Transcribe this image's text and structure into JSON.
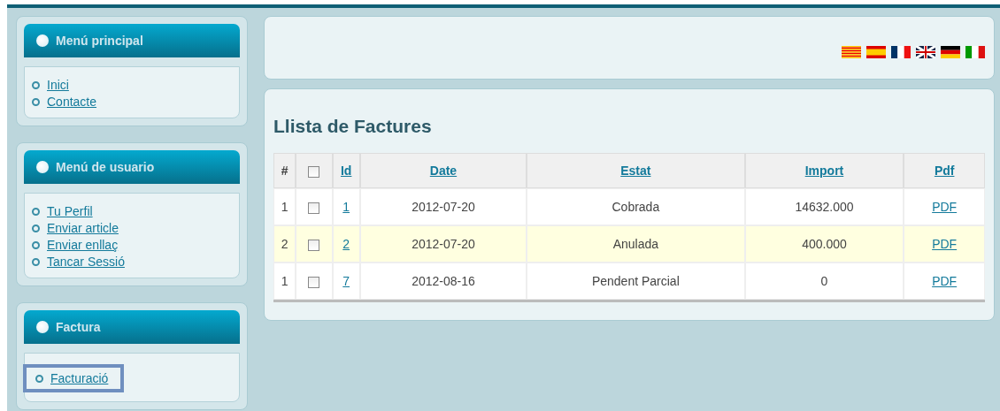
{
  "sidebar": [
    {
      "title": "Menú principal",
      "items": [
        {
          "label": "Inici",
          "highlighted": false
        },
        {
          "label": "Contacte",
          "highlighted": false
        }
      ]
    },
    {
      "title": "Menú de usuario",
      "items": [
        {
          "label": "Tu Perfil",
          "highlighted": false
        },
        {
          "label": "Enviar article",
          "highlighted": false
        },
        {
          "label": "Enviar enllaç",
          "highlighted": false
        },
        {
          "label": "Tancar Sessió",
          "highlighted": false
        }
      ]
    },
    {
      "title": "Factura",
      "items": [
        {
          "label": "Facturació",
          "highlighted": true
        }
      ]
    }
  ],
  "languages": [
    {
      "kind": "ca"
    },
    {
      "kind": "es"
    },
    {
      "kind": "fr"
    },
    {
      "kind": "gb"
    },
    {
      "kind": "de"
    },
    {
      "kind": "it"
    }
  ],
  "page_title": "Llista de Factures",
  "table": {
    "columns": [
      {
        "label": "#",
        "link": false
      },
      {
        "kind": "checkbox",
        "checked": false
      },
      {
        "label": "Id",
        "link": true
      },
      {
        "label": "Date",
        "link": true
      },
      {
        "label": "Estat",
        "link": true
      },
      {
        "label": "Import",
        "link": true
      },
      {
        "label": "Pdf",
        "link": true
      }
    ],
    "rows": [
      {
        "num": "1",
        "checked": false,
        "id": "1",
        "date": "2012-07-20",
        "status": "Cobrada",
        "amount": "14632.000",
        "pdf": "PDF",
        "highlighted": false
      },
      {
        "num": "2",
        "checked": false,
        "id": "2",
        "date": "2012-07-20",
        "status": "Anulada",
        "amount": "400.000",
        "pdf": "PDF",
        "highlighted": true
      },
      {
        "num": "1",
        "checked": false,
        "id": "7",
        "date": "2012-08-16",
        "status": "Pendent Parcial",
        "amount": "0",
        "pdf": "PDF",
        "highlighted": false
      }
    ]
  }
}
